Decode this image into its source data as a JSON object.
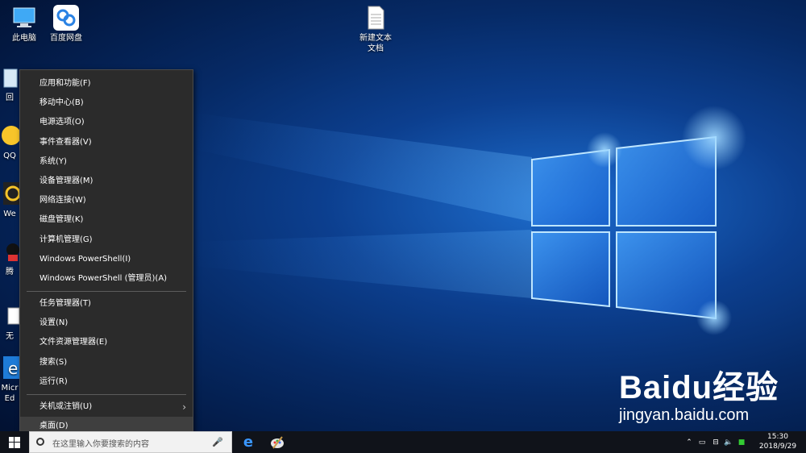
{
  "desktop_icons": [
    {
      "label": "此电脑",
      "icon": "computer-icon"
    },
    {
      "label": "百度网盘",
      "icon": "baidu-netdisk-icon"
    },
    {
      "label": "新建文本文档",
      "icon": "text-file-icon"
    },
    {
      "label": "回",
      "icon": "recycle-bin-icon"
    },
    {
      "label": "QQ",
      "icon": "qq-icon"
    },
    {
      "label": "We",
      "icon": "wechat-icon"
    },
    {
      "label": "腾",
      "icon": "tencent-icon"
    },
    {
      "label": "无",
      "icon": "file-icon"
    },
    {
      "label": "Micr",
      "icon": "edge-icon"
    },
    {
      "label": "Ed",
      "icon": "edge-icon"
    }
  ],
  "menu": {
    "items": [
      "应用和功能(F)",
      "移动中心(B)",
      "电源选项(O)",
      "事件查看器(V)",
      "系统(Y)",
      "设备管理器(M)",
      "网络连接(W)",
      "磁盘管理(K)",
      "计算机管理(G)",
      "Windows PowerShell(I)",
      "Windows PowerShell (管理员)(A)",
      "任务管理器(T)",
      "设置(N)",
      "文件资源管理器(E)",
      "搜索(S)",
      "运行(R)",
      "关机或注销(U)",
      "桌面(D)"
    ]
  },
  "taskbar": {
    "search_placeholder": "在这里输入你要搜索的内容",
    "time": "15:30",
    "date": "2018/9/29"
  },
  "watermark": {
    "brand": "Baidu经验",
    "url": "jingyan.baidu.com"
  }
}
